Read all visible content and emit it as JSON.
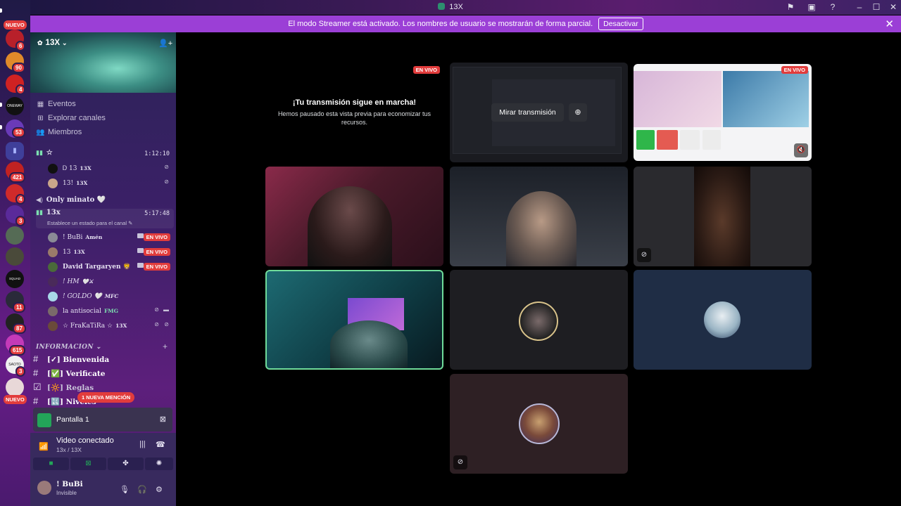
{
  "window": {
    "title": "13X"
  },
  "banner": {
    "text": "El modo Streamer está activado. Los nombres de usuario se mostrarán de forma parcial.",
    "button": "Desactivar"
  },
  "rail": {
    "new_top": "NUEVO",
    "new_bottom": "NUEVO",
    "badges": [
      "6",
      "90",
      "4",
      "53",
      "421",
      "4",
      "3",
      "11",
      "87",
      "615",
      "3"
    ],
    "avatar_labels": [
      "ONEWAY",
      "SQUAD GAMER",
      "SAOTO"
    ]
  },
  "server": {
    "name": "13X",
    "menu": {
      "events": "Eventos",
      "browse": "Explorar canales",
      "members": "Miembros"
    }
  },
  "voice": {
    "channel1": {
      "name": "☆",
      "time": "1:12:10"
    },
    "channel1_members": [
      {
        "name": "Ꭰ 13",
        "tag": "13X"
      },
      {
        "name": "13!",
        "tag": "13X"
      }
    ],
    "only_minato": "Only minato 🤍",
    "channel2": {
      "name": "13x",
      "time": "5:17:48",
      "status": "Establece un estado para el canal"
    },
    "channel2_members": [
      {
        "name": "! BuBi",
        "tag": "Amén",
        "live": "EN VIVO"
      },
      {
        "name": "13",
        "tag": "13X",
        "live": "EN VIVO"
      },
      {
        "name": "David Targaryen 🦁",
        "tag": "",
        "live": "EN VIVO"
      },
      {
        "name": "! HM",
        "tag": "🤍⚔",
        "live": ""
      },
      {
        "name": "! GOLDO 🤍",
        "tag": "MFC",
        "live": ""
      },
      {
        "name": "la antisocial",
        "tag": "FMG",
        "live": ""
      },
      {
        "name": "☆ FraKaTiRa ☆",
        "tag": "13X",
        "live": ""
      }
    ]
  },
  "category": {
    "name": "INFORMACION",
    "channels": [
      {
        "icon": "#",
        "name": "[✓] Bienvenida"
      },
      {
        "icon": "#",
        "name": "[✅] Verificate"
      },
      {
        "icon": "☑",
        "name": "[🔆] Reglas"
      },
      {
        "icon": "#",
        "name": "[🔣] Niveles"
      }
    ]
  },
  "mention": "1 NUEVA MENCIÓN",
  "share": {
    "label": "Pantalla 1"
  },
  "connection": {
    "title": "Video conectado",
    "subtitle": "13x / 13X"
  },
  "user": {
    "name": "! BuBi",
    "status": "Invisible"
  },
  "stage": {
    "paused_title": "¡Tu transmisión sigue en marcha!",
    "paused_text": "Hemos pausado esta vista previa para economizar tus recursos.",
    "en_vivo": "EN VIVO",
    "watch_stream": "Mirar transmisión"
  },
  "colors": {
    "accent_live": "#e23c3c",
    "banner": "#9b3fd6",
    "speaking_border": "#6fdc9a"
  }
}
